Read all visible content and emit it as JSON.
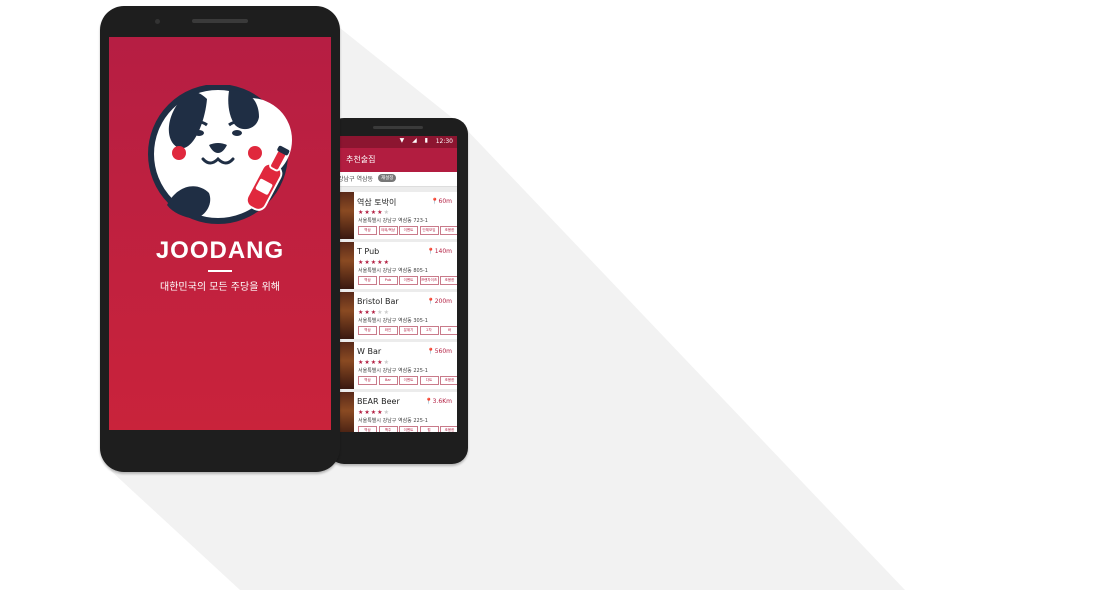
{
  "splash": {
    "brand": "JOODANG",
    "tagline": "대한민국의 모든 주당을 위해"
  },
  "list_screen": {
    "status_time": "12:30",
    "status_icons": "▼ ◢ ▮",
    "title": "추천술집",
    "location": "강남구 역삼동",
    "location_button": "재설정",
    "items": [
      {
        "name": "역삼 토박이",
        "distance": "60m",
        "rating": 4,
        "address": "서울특별시 강남구 역삼동 723-1",
        "tags": [
          "역삼",
          "야외/옥상",
          "이벤트",
          "단체모임",
          "조용한"
        ]
      },
      {
        "name": "T Pub",
        "distance": "140m",
        "rating": 5,
        "address": "서울특별시 강남구 역삼동 805-1",
        "tags": [
          "역삼",
          "Pub",
          "이벤트",
          "프랜차이즈",
          "조용한"
        ]
      },
      {
        "name": "Bristol Bar",
        "distance": "200m",
        "rating": 3,
        "address": "서울특별시 강남구 역삼동 305-1",
        "tags": [
          "역삼",
          "와인",
          "분위기",
          "2차",
          "바"
        ]
      },
      {
        "name": "W Bar",
        "distance": "560m",
        "rating": 4,
        "address": "서울특별시 강남구 역삼동 225-1",
        "tags": [
          "역삼",
          "Bar",
          "이벤트",
          "다트",
          "조용한"
        ]
      },
      {
        "name": "BEAR Beer",
        "distance": "3.6Km",
        "rating": 4,
        "address": "서울특별시 강남구 역삼동 225-1",
        "tags": [
          "역삼",
          "맥주",
          "이벤트",
          "펍",
          "조용한"
        ]
      }
    ]
  },
  "colors": {
    "brand": "#b61e43",
    "status_bar": "#8c1530",
    "app_bar": "#b21d40",
    "shadow": "#f2f2f2"
  },
  "icons": [
    "dog-face-logo-icon",
    "bottle-icon",
    "location-pin-icon",
    "star-icon",
    "wifi-icon",
    "signal-icon",
    "battery-icon"
  ]
}
